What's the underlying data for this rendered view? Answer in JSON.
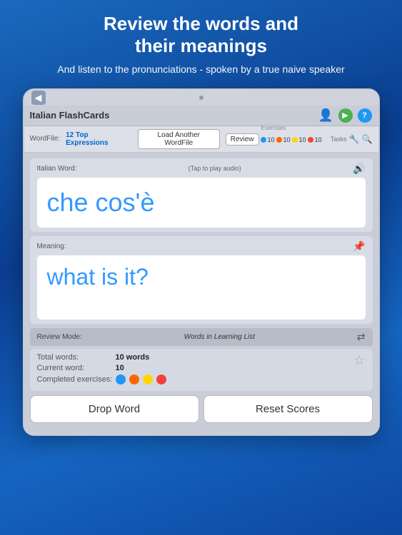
{
  "header": {
    "title1": "Review the words and",
    "title2": "their meanings",
    "subtitle": "And listen to the pronunciations - spoken by a true naive speaker"
  },
  "navbar": {
    "title": "Italian FlashCards",
    "back_icon": "◀",
    "person_icon": "👤",
    "play_icon": "▶",
    "help_icon": "?"
  },
  "wordfile_bar": {
    "label": "WordFile:",
    "name": "12 Top Expressions",
    "load_button": "Load Another WordFile",
    "exercises_label": "Exercises",
    "review_button": "Review",
    "blue_count": "10",
    "orange_count": "10",
    "yellow_count": "10",
    "red_count": "10",
    "tasks_label": "Tasks",
    "wrench_icon": "🔧",
    "search_icon": "🔍"
  },
  "italian_word": {
    "label": "Italian Word:",
    "tap_label": "(Tap to play audio)",
    "word": "che cos'è"
  },
  "meaning": {
    "label": "Meaning:",
    "text": "what is it?"
  },
  "review_mode": {
    "label": "Review Mode:",
    "value": "Words in Learning List",
    "shuffle_icon": "⇄"
  },
  "stats": {
    "total_label": "Total words:",
    "total_value": "10 words",
    "current_label": "Current word:",
    "current_value": "10",
    "completed_label": "Completed exercises:"
  },
  "buttons": {
    "drop_word": "Drop Word",
    "reset_scores": "Reset Scores"
  }
}
